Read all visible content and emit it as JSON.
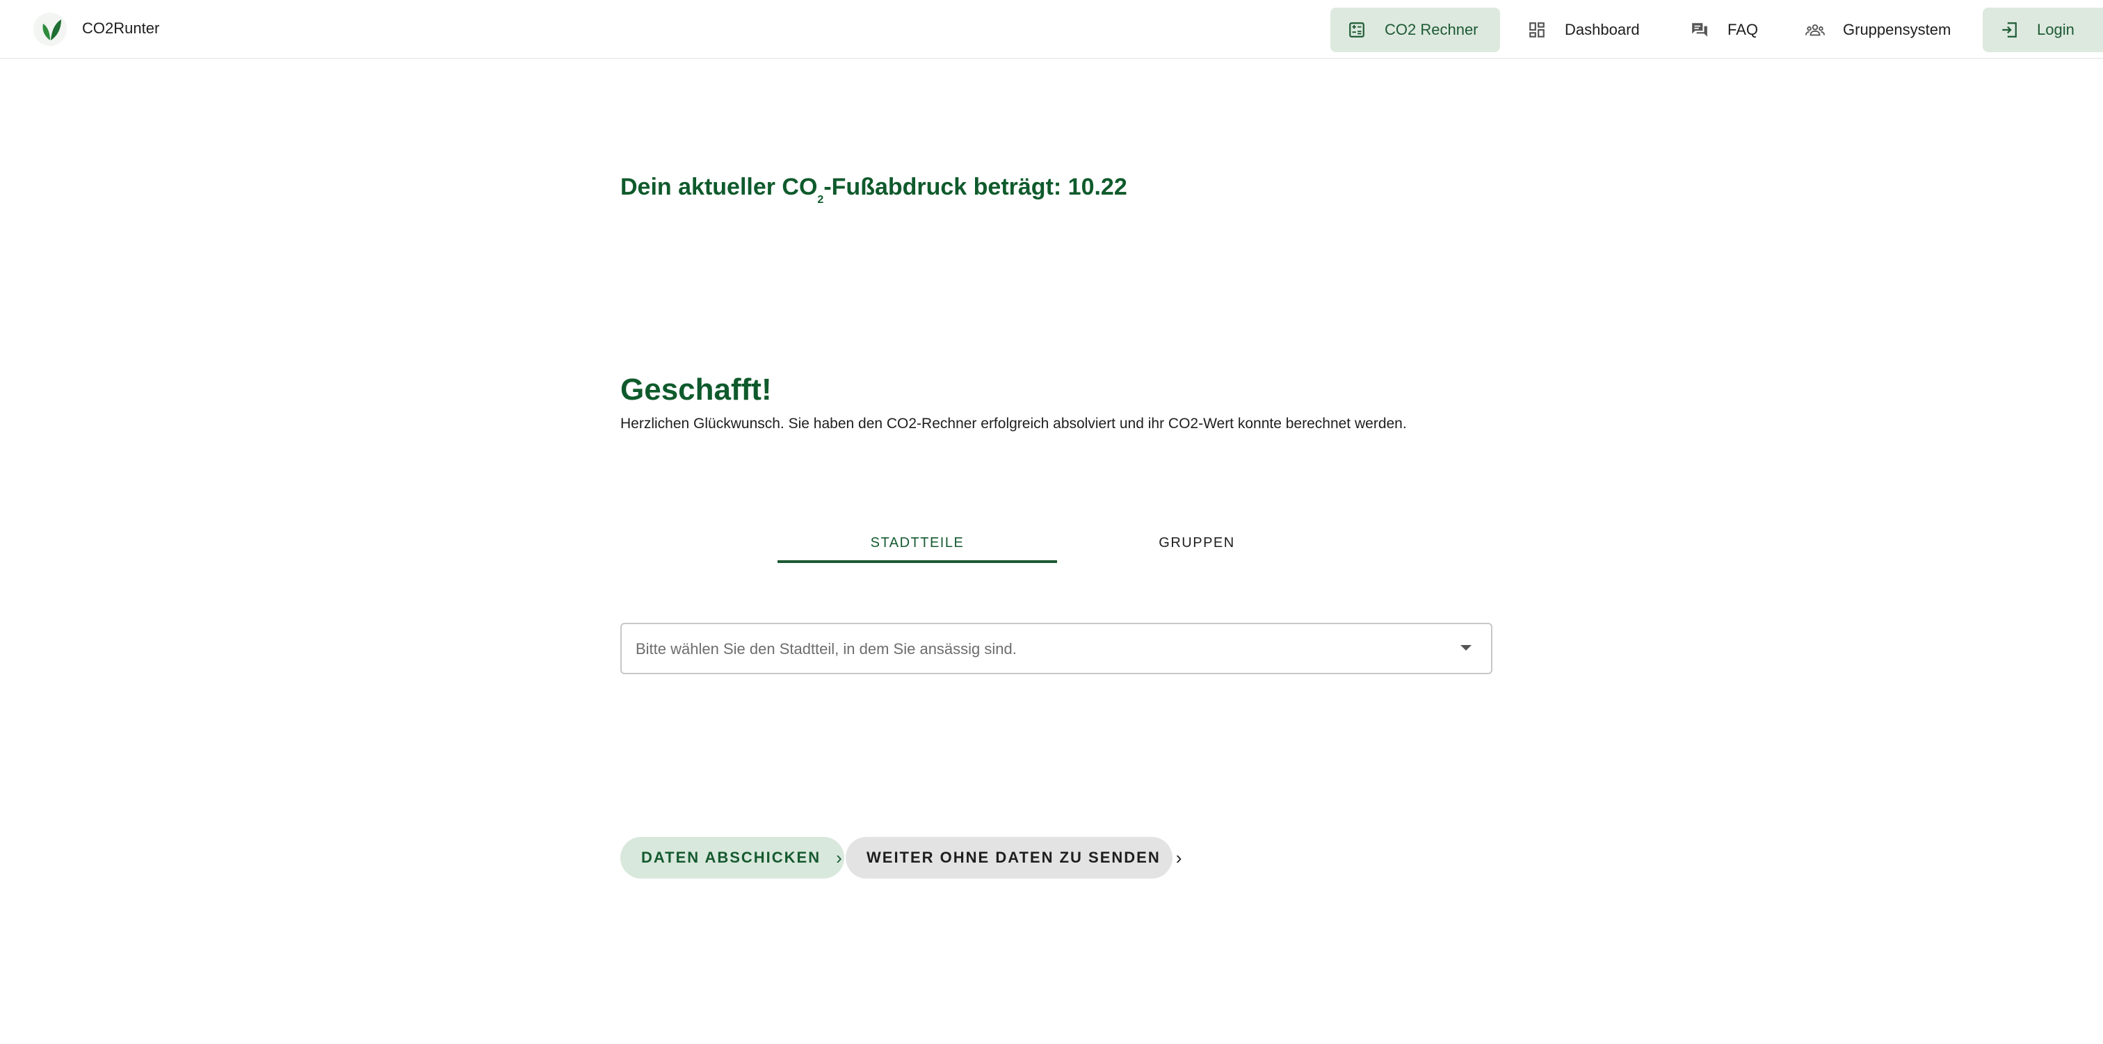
{
  "header": {
    "brand": "CO2Runter",
    "nav": [
      {
        "label": "CO2 Rechner",
        "icon": "calculator-icon",
        "active": true
      },
      {
        "label": "Dashboard",
        "icon": "dashboard-icon",
        "active": false
      },
      {
        "label": "FAQ",
        "icon": "forum-icon",
        "active": false
      },
      {
        "label": "Gruppensystem",
        "icon": "groups-icon",
        "active": false
      },
      {
        "label": "Login",
        "icon": "login-icon",
        "active": true
      }
    ]
  },
  "result": {
    "prefix": "Dein aktueller CO",
    "subscript": "2",
    "suffix": "-Fußabdruck beträgt: 10.22"
  },
  "completion": {
    "title": "Geschafft!",
    "message": "Herzlichen Glückwunsch. Sie haben den CO2-Rechner erfolgreich absolviert und ihr CO2-Wert konnte berechnet werden."
  },
  "tabs": [
    {
      "label": "STADTTEILE",
      "active": true
    },
    {
      "label": "GRUPPEN",
      "active": false
    }
  ],
  "district_select": {
    "placeholder": "Bitte wählen Sie den Stadtteil, in dem Sie ansässig sind.",
    "icon": "arrow-drop-down-icon"
  },
  "actions": {
    "send_label": "DATEN ABSCHICKEN",
    "skip_label": "WEITER OHNE DATEN ZU SENDEN",
    "icon": "chevron-right-icon"
  },
  "colors": {
    "accent": "#0f5a2c",
    "active_bg": "#dde9df",
    "secondary_bg": "#e3e3e3"
  }
}
